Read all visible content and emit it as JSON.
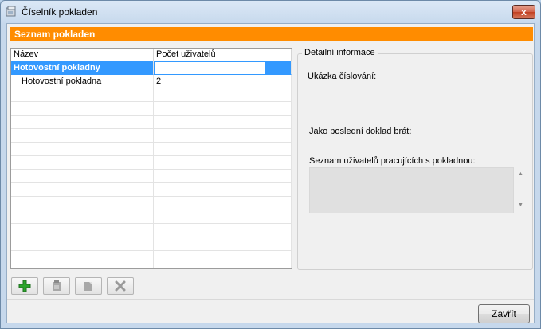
{
  "window": {
    "title": "Číselník pokladen",
    "close_glyph": "x"
  },
  "section": {
    "title": "Seznam pokladen"
  },
  "grid": {
    "columns": [
      "Název",
      "Počet uživatelů"
    ],
    "rows": [
      {
        "name": "Hotovostní pokladny",
        "count": "",
        "type": "group",
        "selected": true
      },
      {
        "name": "Hotovostní pokladna",
        "count": "2",
        "type": "item",
        "selected": false
      }
    ]
  },
  "detail": {
    "legend": "Detailní informace",
    "numbering_label": "Ukázka číslování:",
    "last_doc_label": "Jako poslední doklad brát:",
    "users_label": "Seznam uživatelů pracujících s pokladnou:"
  },
  "toolbar": {
    "buttons": [
      {
        "icon": "add-icon",
        "enabled": true
      },
      {
        "icon": "edit-icon",
        "enabled": false
      },
      {
        "icon": "copy-icon",
        "enabled": false
      },
      {
        "icon": "delete-icon",
        "enabled": false
      }
    ]
  },
  "footer": {
    "close_label": "Zavřít"
  },
  "colors": {
    "header": "#ff8c00",
    "selection": "#3399ff",
    "add_green": "#2aa52a"
  }
}
